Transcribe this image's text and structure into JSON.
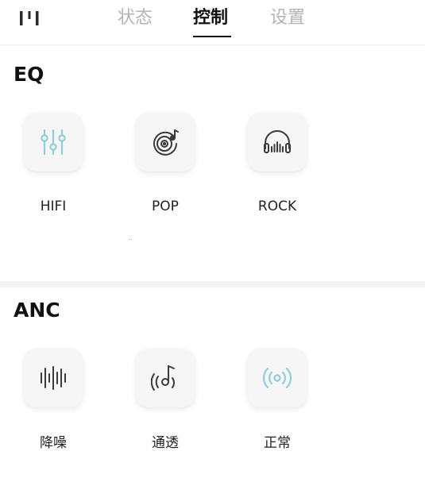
{
  "header": {
    "tabs": [
      {
        "label": "状态",
        "active": false
      },
      {
        "label": "控制",
        "active": true
      },
      {
        "label": "设置",
        "active": false
      }
    ]
  },
  "eq": {
    "title": "EQ",
    "options": [
      {
        "label": "HIFI",
        "icon": "equalizer-sliders-icon",
        "color": "#8fcfd6"
      },
      {
        "label": "POP",
        "icon": "vinyl-record-icon",
        "color": "#3a3a3a"
      },
      {
        "label": "ROCK",
        "icon": "headphones-icon",
        "color": "#3a3a3a"
      }
    ]
  },
  "anc": {
    "title": "ANC",
    "options": [
      {
        "label": "降噪",
        "icon": "soundwave-icon",
        "color": "#3a3a3a"
      },
      {
        "label": "通透",
        "icon": "music-note-waves-icon",
        "color": "#3a3a3a"
      },
      {
        "label": "正常",
        "icon": "broadcast-icon",
        "color": "#8fcfd6"
      }
    ]
  },
  "colors": {
    "active_tab": "#111111",
    "inactive_tab": "#b3b3b3",
    "accent": "#8fcfd6",
    "tile_bg": "#f6f6f6"
  }
}
